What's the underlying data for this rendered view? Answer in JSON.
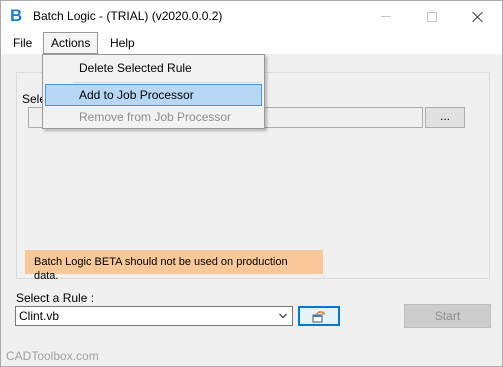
{
  "window": {
    "title": "Batch Logic - (TRIAL) (v2020.0.0.2)",
    "app_icon_letter": "B",
    "accent_color": "#1a7fd4"
  },
  "menubar": {
    "items": [
      {
        "label": "File"
      },
      {
        "label": "Actions"
      },
      {
        "label": "Help"
      }
    ]
  },
  "actions_menu": {
    "items": [
      {
        "label": "Delete Selected Rule",
        "enabled": true
      },
      {
        "label": "Add to Job Processor",
        "enabled": true,
        "highlighted": true
      },
      {
        "label": "Remove from Job Processor",
        "enabled": false
      }
    ]
  },
  "main": {
    "select_label_partial": "Sele",
    "path_value": "",
    "browse_label": "...",
    "warning_text": "Batch Logic BETA should not be used on production data.",
    "warning_color": "#f9c898"
  },
  "rule": {
    "label": "Select a Rule :",
    "selected_value": "Clint.vb",
    "refresh_icon": "refresh-icon",
    "start_label": "Start"
  },
  "footer": {
    "text": "CADToolbox.com"
  }
}
